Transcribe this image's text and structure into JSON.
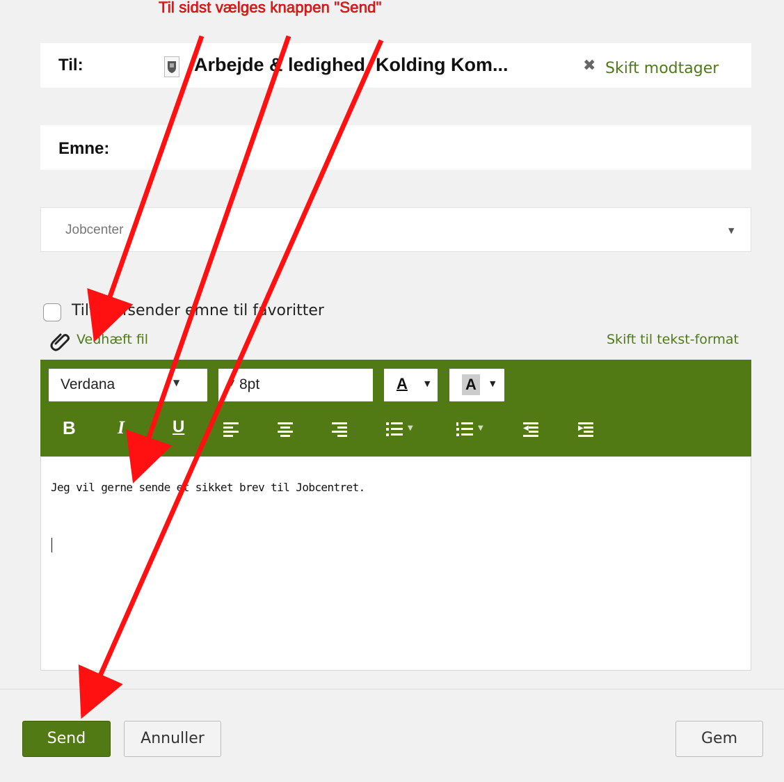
{
  "annotation": {
    "text": "Til sidst vælges knappen \"Send\""
  },
  "recipient": {
    "label": "Til:",
    "name": "Arbejde & ledighed, Kolding Kom...",
    "switch_link": "Skift modtager"
  },
  "subject": {
    "label": "Emne:"
  },
  "category_select": {
    "value": "Jobcenter"
  },
  "favorites_checkbox": {
    "label": "Tilføj afsender emne til favoritter",
    "checked": false
  },
  "attachment": {
    "link": "Vedhæft fil"
  },
  "text_format_link": "Skift til tekst-format",
  "toolbar": {
    "font_family": "Verdana",
    "font_size": "8pt",
    "text_color_letter": "A",
    "bg_color_letter": "A",
    "bold": "B",
    "italic": "I",
    "underline": "U"
  },
  "editor": {
    "body": "Jeg vil gerne sende et sikket brev til Jobcentret."
  },
  "footer": {
    "send": "Send",
    "cancel": "Annuller",
    "save": "Gem"
  },
  "colors": {
    "accent": "#527a14",
    "link": "#4f7a1b",
    "annotation": "#ff1a1a"
  }
}
